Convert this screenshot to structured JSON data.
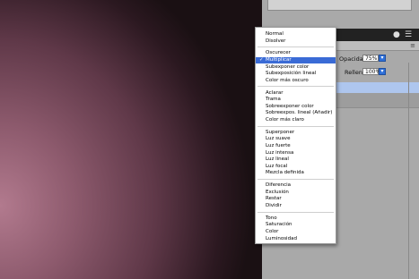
{
  "layers_panel": {
    "opacity_label": "Opacidad:",
    "opacity_value": "75%",
    "fill_label": "Relleno:",
    "fill_value": "100%"
  },
  "blend_menu": {
    "selected": "Multiplicar",
    "groups": [
      [
        "Normal",
        "Disolver"
      ],
      [
        "Oscurecer",
        "Multiplicar",
        "Subexponer color",
        "Subexposición lineal",
        "Color más oscuro"
      ],
      [
        "Aclarar",
        "Trama",
        "Sobreexponer color",
        "Sobreexpos. lineal (Añadir)",
        "Color más claro"
      ],
      [
        "Superponer",
        "Luz suave",
        "Luz fuerte",
        "Luz intensa",
        "Luz lineal",
        "Luz focal",
        "Mezcla definida"
      ],
      [
        "Diferencia",
        "Exclusión",
        "Restar",
        "Dividir"
      ],
      [
        "Tono",
        "Saturación",
        "Color",
        "Luminosidad"
      ]
    ]
  },
  "colors": {
    "accent": "#3a6bd6",
    "layer_highlight": "#aec6ee"
  }
}
